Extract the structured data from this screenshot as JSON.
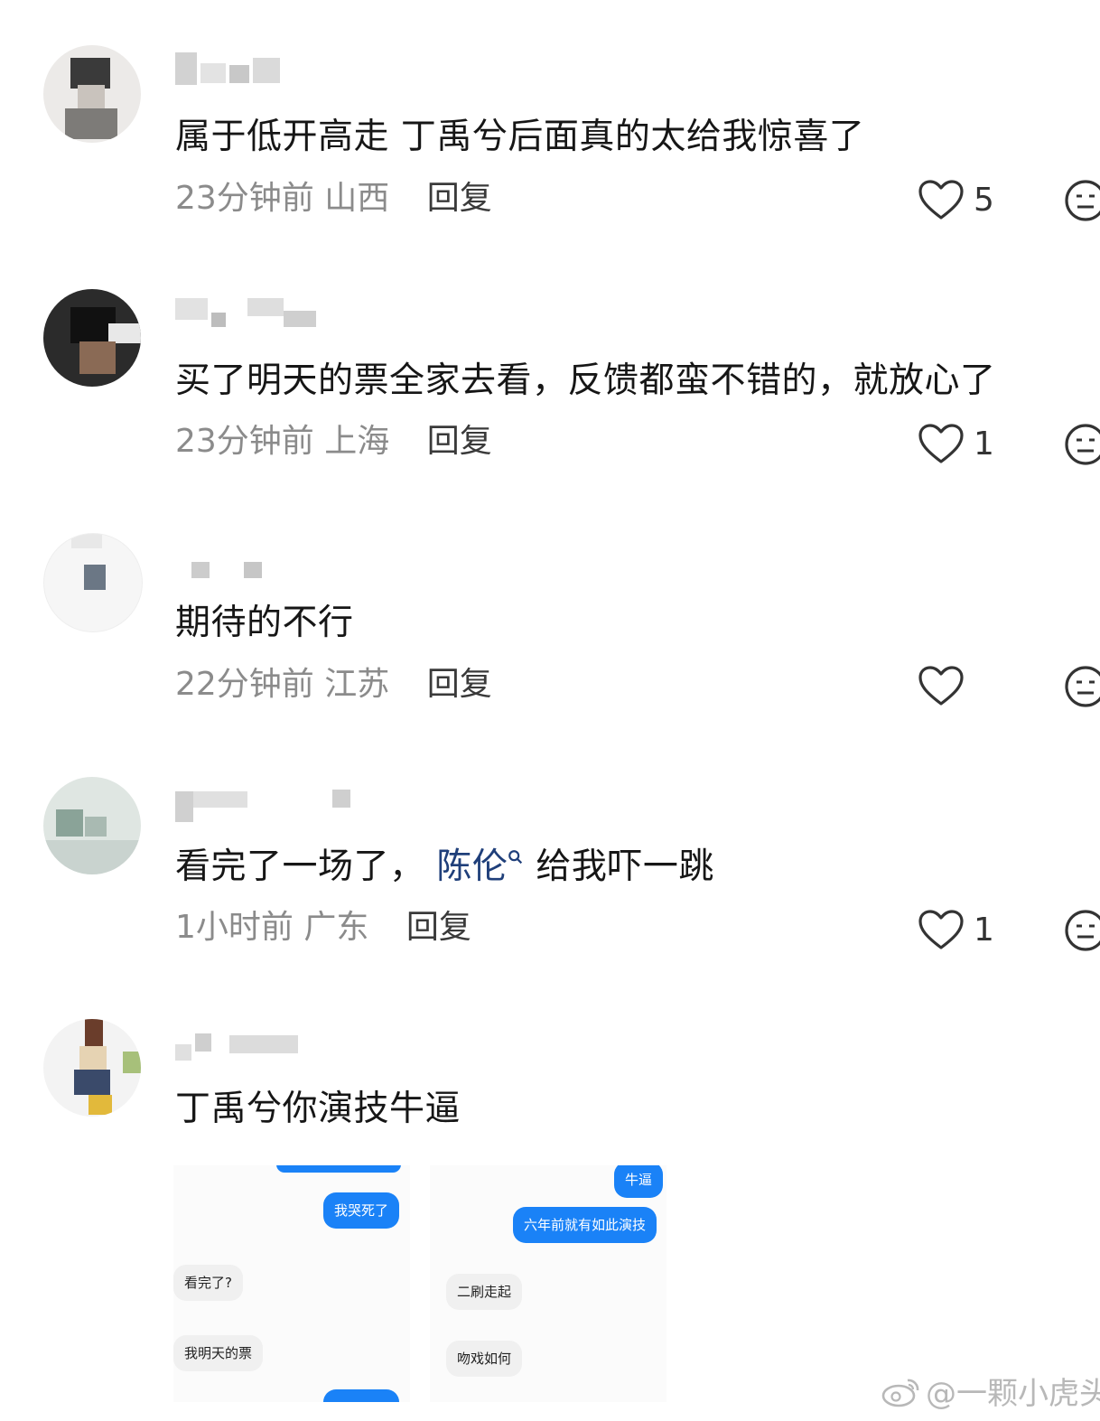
{
  "comments": [
    {
      "text": "属于低开高走 丁禹兮后面真的太给我惊喜了",
      "time": "23分钟前",
      "location": "山西",
      "reply": "回复",
      "likes": "5"
    },
    {
      "text": "买了明天的票全家去看，反馈都蛮不错的，就放心了",
      "time": "23分钟前",
      "location": "上海",
      "reply": "回复",
      "likes": "1"
    },
    {
      "text": "期待的不行",
      "time": "22分钟前",
      "location": "江苏",
      "reply": "回复",
      "likes": ""
    },
    {
      "text_before": "看完了一场了，",
      "mention": "陈伦",
      "text_after": "给我吓一跳",
      "time": "1小时前",
      "location": "广东",
      "reply": "回复",
      "likes": "1"
    },
    {
      "text": "丁禹兮你演技牛逼"
    }
  ],
  "screenshots": {
    "left": [
      "我哭死了",
      "看完了?",
      "我明天的票"
    ],
    "right": [
      "牛逼",
      "六年前就有如此演技",
      "二刷走起",
      "吻戏如何"
    ]
  },
  "watermark": "@一颗小虎头"
}
